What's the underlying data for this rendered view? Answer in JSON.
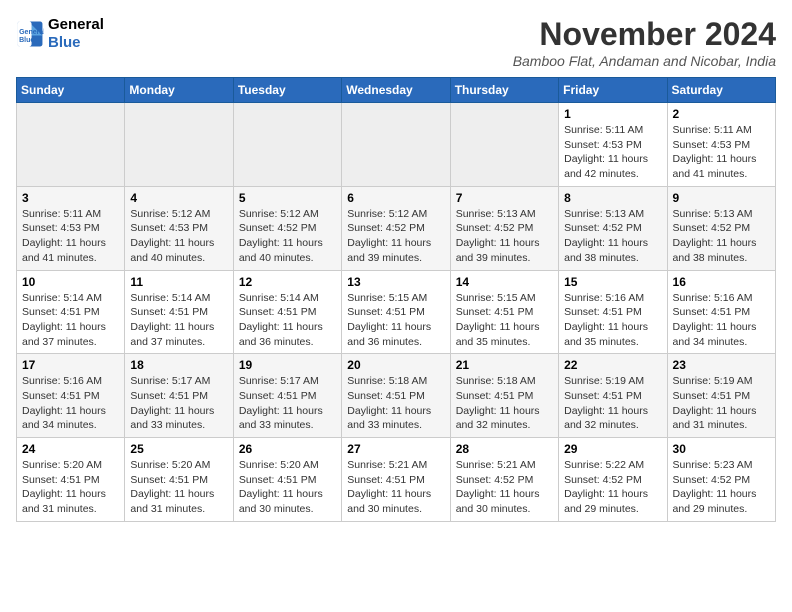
{
  "header": {
    "logo_line1": "General",
    "logo_line2": "Blue",
    "month": "November 2024",
    "location": "Bamboo Flat, Andaman and Nicobar, India"
  },
  "weekdays": [
    "Sunday",
    "Monday",
    "Tuesday",
    "Wednesday",
    "Thursday",
    "Friday",
    "Saturday"
  ],
  "weeks": [
    [
      {
        "day": "",
        "info": ""
      },
      {
        "day": "",
        "info": ""
      },
      {
        "day": "",
        "info": ""
      },
      {
        "day": "",
        "info": ""
      },
      {
        "day": "",
        "info": ""
      },
      {
        "day": "1",
        "info": "Sunrise: 5:11 AM\nSunset: 4:53 PM\nDaylight: 11 hours\nand 42 minutes."
      },
      {
        "day": "2",
        "info": "Sunrise: 5:11 AM\nSunset: 4:53 PM\nDaylight: 11 hours\nand 41 minutes."
      }
    ],
    [
      {
        "day": "3",
        "info": "Sunrise: 5:11 AM\nSunset: 4:53 PM\nDaylight: 11 hours\nand 41 minutes."
      },
      {
        "day": "4",
        "info": "Sunrise: 5:12 AM\nSunset: 4:53 PM\nDaylight: 11 hours\nand 40 minutes."
      },
      {
        "day": "5",
        "info": "Sunrise: 5:12 AM\nSunset: 4:52 PM\nDaylight: 11 hours\nand 40 minutes."
      },
      {
        "day": "6",
        "info": "Sunrise: 5:12 AM\nSunset: 4:52 PM\nDaylight: 11 hours\nand 39 minutes."
      },
      {
        "day": "7",
        "info": "Sunrise: 5:13 AM\nSunset: 4:52 PM\nDaylight: 11 hours\nand 39 minutes."
      },
      {
        "day": "8",
        "info": "Sunrise: 5:13 AM\nSunset: 4:52 PM\nDaylight: 11 hours\nand 38 minutes."
      },
      {
        "day": "9",
        "info": "Sunrise: 5:13 AM\nSunset: 4:52 PM\nDaylight: 11 hours\nand 38 minutes."
      }
    ],
    [
      {
        "day": "10",
        "info": "Sunrise: 5:14 AM\nSunset: 4:51 PM\nDaylight: 11 hours\nand 37 minutes."
      },
      {
        "day": "11",
        "info": "Sunrise: 5:14 AM\nSunset: 4:51 PM\nDaylight: 11 hours\nand 37 minutes."
      },
      {
        "day": "12",
        "info": "Sunrise: 5:14 AM\nSunset: 4:51 PM\nDaylight: 11 hours\nand 36 minutes."
      },
      {
        "day": "13",
        "info": "Sunrise: 5:15 AM\nSunset: 4:51 PM\nDaylight: 11 hours\nand 36 minutes."
      },
      {
        "day": "14",
        "info": "Sunrise: 5:15 AM\nSunset: 4:51 PM\nDaylight: 11 hours\nand 35 minutes."
      },
      {
        "day": "15",
        "info": "Sunrise: 5:16 AM\nSunset: 4:51 PM\nDaylight: 11 hours\nand 35 minutes."
      },
      {
        "day": "16",
        "info": "Sunrise: 5:16 AM\nSunset: 4:51 PM\nDaylight: 11 hours\nand 34 minutes."
      }
    ],
    [
      {
        "day": "17",
        "info": "Sunrise: 5:16 AM\nSunset: 4:51 PM\nDaylight: 11 hours\nand 34 minutes."
      },
      {
        "day": "18",
        "info": "Sunrise: 5:17 AM\nSunset: 4:51 PM\nDaylight: 11 hours\nand 33 minutes."
      },
      {
        "day": "19",
        "info": "Sunrise: 5:17 AM\nSunset: 4:51 PM\nDaylight: 11 hours\nand 33 minutes."
      },
      {
        "day": "20",
        "info": "Sunrise: 5:18 AM\nSunset: 4:51 PM\nDaylight: 11 hours\nand 33 minutes."
      },
      {
        "day": "21",
        "info": "Sunrise: 5:18 AM\nSunset: 4:51 PM\nDaylight: 11 hours\nand 32 minutes."
      },
      {
        "day": "22",
        "info": "Sunrise: 5:19 AM\nSunset: 4:51 PM\nDaylight: 11 hours\nand 32 minutes."
      },
      {
        "day": "23",
        "info": "Sunrise: 5:19 AM\nSunset: 4:51 PM\nDaylight: 11 hours\nand 31 minutes."
      }
    ],
    [
      {
        "day": "24",
        "info": "Sunrise: 5:20 AM\nSunset: 4:51 PM\nDaylight: 11 hours\nand 31 minutes."
      },
      {
        "day": "25",
        "info": "Sunrise: 5:20 AM\nSunset: 4:51 PM\nDaylight: 11 hours\nand 31 minutes."
      },
      {
        "day": "26",
        "info": "Sunrise: 5:20 AM\nSunset: 4:51 PM\nDaylight: 11 hours\nand 30 minutes."
      },
      {
        "day": "27",
        "info": "Sunrise: 5:21 AM\nSunset: 4:51 PM\nDaylight: 11 hours\nand 30 minutes."
      },
      {
        "day": "28",
        "info": "Sunrise: 5:21 AM\nSunset: 4:52 PM\nDaylight: 11 hours\nand 30 minutes."
      },
      {
        "day": "29",
        "info": "Sunrise: 5:22 AM\nSunset: 4:52 PM\nDaylight: 11 hours\nand 29 minutes."
      },
      {
        "day": "30",
        "info": "Sunrise: 5:23 AM\nSunset: 4:52 PM\nDaylight: 11 hours\nand 29 minutes."
      }
    ]
  ]
}
